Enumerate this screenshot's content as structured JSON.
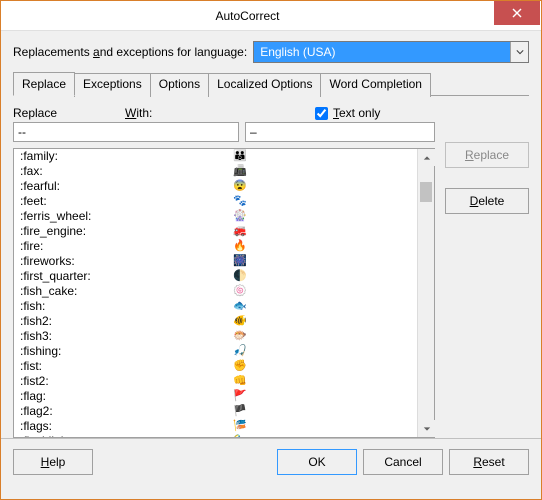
{
  "window": {
    "title": "AutoCorrect"
  },
  "lang": {
    "label_pre": "Replacements ",
    "label_u": "a",
    "label_post": "nd exceptions for language:",
    "value": "English (USA)"
  },
  "tabs": [
    {
      "label": "Replace",
      "active": true
    },
    {
      "label": "Exceptions",
      "active": false
    },
    {
      "label": "Options",
      "active": false
    },
    {
      "label": "Localized Options",
      "active": false
    },
    {
      "label": "Word Completion",
      "active": false
    }
  ],
  "fields": {
    "replace_label": "Replace",
    "with_label_u": "W",
    "with_label_post": "ith:",
    "textonly_u": "T",
    "textonly_post": "ext only",
    "textonly_checked": true,
    "replace_value": "--",
    "with_value": "–"
  },
  "side": {
    "replace_u": "R",
    "replace_post": "eplace",
    "delete_u": "D",
    "delete_post": "elete"
  },
  "list": {
    "items": [
      {
        "key": ":family:",
        "val": "👪"
      },
      {
        "key": ":fax:",
        "val": "📠"
      },
      {
        "key": ":fearful:",
        "val": "😨"
      },
      {
        "key": ":feet:",
        "val": "🐾"
      },
      {
        "key": ":ferris_wheel:",
        "val": "🎡"
      },
      {
        "key": ":fire_engine:",
        "val": "🚒"
      },
      {
        "key": ":fire:",
        "val": "🔥"
      },
      {
        "key": ":fireworks:",
        "val": "🎆"
      },
      {
        "key": ":first_quarter:",
        "val": "🌓"
      },
      {
        "key": ":fish_cake:",
        "val": "🍥"
      },
      {
        "key": ":fish:",
        "val": "🐟"
      },
      {
        "key": ":fish2:",
        "val": "🐠"
      },
      {
        "key": ":fish3:",
        "val": "🐡"
      },
      {
        "key": ":fishing:",
        "val": "🎣"
      },
      {
        "key": ":fist:",
        "val": "✊"
      },
      {
        "key": ":fist2:",
        "val": "👊"
      },
      {
        "key": ":flag:",
        "val": "🚩"
      },
      {
        "key": ":flag2:",
        "val": "🏴"
      },
      {
        "key": ":flags:",
        "val": "🎏"
      },
      {
        "key": ":flashlight:",
        "val": "🔦"
      }
    ]
  },
  "buttons": {
    "help_u": "H",
    "help_post": "elp",
    "ok": "OK",
    "cancel": "Cancel",
    "reset_u": "R",
    "reset_post": "eset"
  },
  "colors": {
    "accent": "#3399ff",
    "window_border": "#d97f2a",
    "close": "#c75050"
  }
}
